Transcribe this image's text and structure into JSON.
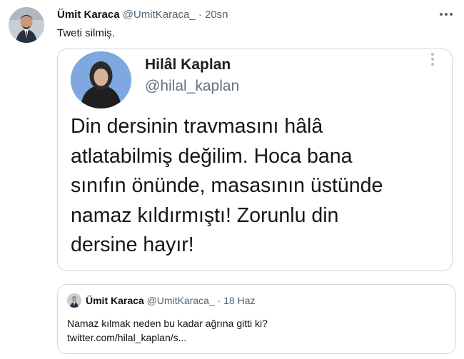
{
  "tweet": {
    "author_name": "Ümit Karaca",
    "author_handle": "@UmitKaraca_",
    "separator": "·",
    "time": "20sn",
    "text": "Tweti silmiş.",
    "more_icon": "more-horizontal-icon"
  },
  "embedded_screenshot": {
    "author_name": "Hilâl Kaplan",
    "author_handle": "@hilal_kaplan",
    "text_lines": [
      "Din dersinin travmasını hâlâ",
      "atlatabilmiş değilim. Hoca bana",
      "sınıfın önünde, masasının üstünde",
      "namaz kıldırmıştı! Zorunlu din",
      "dersine hayır!"
    ],
    "more_icon": "more-vertical-icon"
  },
  "quoted_tweet": {
    "author_name": "Ümit Karaca",
    "author_handle": "@UmitKaraca_",
    "separator": "·",
    "date": "18 Haz",
    "text_line_1": "Namaz kılmak neden bu kadar ağrına gitti ki?",
    "text_line_2": "twitter.com/hilal_kaplan/s..."
  }
}
